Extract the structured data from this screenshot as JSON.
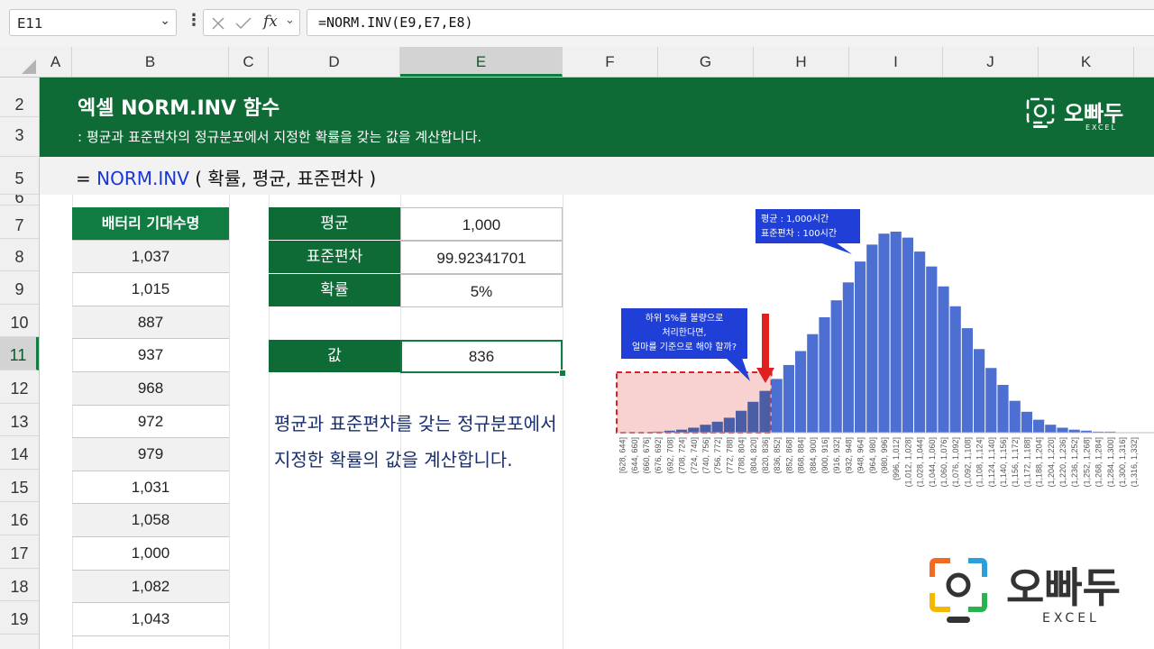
{
  "formula_bar": {
    "name_box": "E11",
    "formula": "=NORM.INV(E9,E7,E8)"
  },
  "columns": [
    "A",
    "B",
    "C",
    "D",
    "E",
    "F",
    "G",
    "H",
    "I",
    "J",
    "K"
  ],
  "selected_column": "E",
  "rows": [
    "2",
    "3",
    "5",
    "6",
    "7",
    "8",
    "9",
    "10",
    "11",
    "12",
    "13",
    "14",
    "15",
    "16",
    "17",
    "18",
    "19"
  ],
  "selected_row": "11",
  "banner": {
    "title": "엑셀 NORM.INV 함수",
    "subtitle": ": 평균과 표준편차의 정규분포에서 지정한 확률을 갖는 값을 계산합니다.",
    "logo_text": "오빠두",
    "logo_sub": "EXCEL"
  },
  "syntax": {
    "prefix": "= ",
    "function": "NORM.INV",
    "args": " ( 확률, 평균, 표준편차 )"
  },
  "battery_table": {
    "header": "배터리 기대수명",
    "values": [
      "1,037",
      "1,015",
      "887",
      "937",
      "968",
      "972",
      "979",
      "1,031",
      "1,058",
      "1,000",
      "1,082",
      "1,043"
    ]
  },
  "params": {
    "mean_label": "평균",
    "mean_value": "1,000",
    "sd_label": "표준편차",
    "sd_value": "99.92341701",
    "prob_label": "확률",
    "prob_value": "5%",
    "result_label": "값",
    "result_value": "836"
  },
  "description": {
    "line1": "평균과 표준편차를 갖는 정규분포에서",
    "line2": "지정한 확률의 값을 계산합니다."
  },
  "chart_data": {
    "type": "bar",
    "categories": [
      "[628, 644]",
      "(644, 660]",
      "(660, 676]",
      "(676, 692]",
      "(692, 708]",
      "(708, 724]",
      "(724, 740]",
      "(740, 756]",
      "(756, 772]",
      "(772, 788]",
      "(788, 804]",
      "(804, 820]",
      "(820, 836]",
      "(836, 852]",
      "(852, 868]",
      "(868, 884]",
      "(884, 900]",
      "(900, 916]",
      "(916, 932]",
      "(932, 948]",
      "(948, 964]",
      "(964, 980]",
      "(980, 996]",
      "(996, 1,012]",
      "(1,012, 1,028]",
      "(1,028, 1,044]",
      "(1,044, 1,060]",
      "(1,060, 1,076]",
      "(1,076, 1,092]",
      "(1,092, 1,108]",
      "(1,108, 1,124]",
      "(1,124, 1,140]",
      "(1,140, 1,156]",
      "(1,156, 1,172]",
      "(1,172, 1,188]",
      "(1,188, 1,204]",
      "(1,204, 1,220]",
      "(1,220, 1,236]",
      "(1,236, 1,252]",
      "(1,252, 1,268]",
      "(1,268, 1,284]",
      "(1,284, 1,300]",
      "(1,300, 1,316]",
      "(1,316, 1,332]"
    ],
    "values": [
      0,
      0,
      0,
      1,
      2,
      3,
      5,
      8,
      11,
      15,
      22,
      31,
      42,
      54,
      68,
      82,
      99,
      116,
      133,
      151,
      172,
      189,
      200,
      202,
      196,
      182,
      167,
      147,
      127,
      105,
      84,
      65,
      48,
      32,
      21,
      13,
      8,
      5,
      3,
      2,
      1,
      1,
      0,
      0
    ],
    "highlight_until_index": 12,
    "colors": {
      "bar": "#4c6fd1",
      "highlight_bar": "#2d4a9e",
      "shade": "#f8d1d1",
      "arrow": "#e02020",
      "callout": "#1f3fd6"
    },
    "grid": false,
    "callouts": {
      "top": [
        "평균 : 1,000시간",
        "표준편차 : 100시간"
      ],
      "left": [
        "하위 5%를 불량으로",
        "처리한다면,",
        "얼마를 기준으로 해야 할까?"
      ]
    }
  },
  "logo_big": {
    "text": "오빠두",
    "sub": "EXCEL"
  }
}
